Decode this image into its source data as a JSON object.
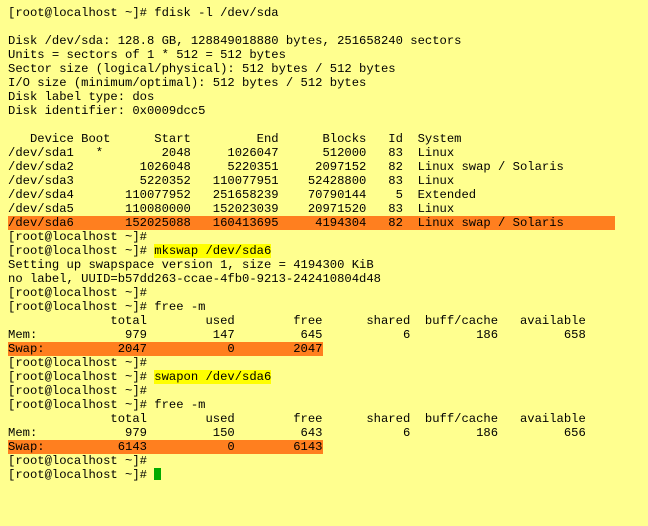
{
  "prompt": "[root@localhost ~]# ",
  "cmd_fdisk": "fdisk -l /dev/sda",
  "cmd_mkswap": "mkswap /dev/sda6",
  "cmd_free": "free -m",
  "cmd_swapon": "swapon /dev/sda6",
  "disk_header": {
    "l1": "Disk /dev/sda: 128.8 GB, 128849018880 bytes, 251658240 sectors",
    "l2": "Units = sectors of 1 * 512 = 512 bytes",
    "l3": "Sector size (logical/physical): 512 bytes / 512 bytes",
    "l4": "I/O size (minimum/optimal): 512 bytes / 512 bytes",
    "l5": "Disk label type: dos",
    "l6": "Disk identifier: 0x0009dcc5"
  },
  "part_header": "   Device Boot      Start         End      Blocks   Id  System",
  "partitions": [
    "/dev/sda1   *        2048     1026047      512000   83  Linux",
    "/dev/sda2         1026048     5220351     2097152   82  Linux swap / Solaris",
    "/dev/sda3         5220352   110077951    52428800   83  Linux",
    "/dev/sda4       110077952   251658239    70790144    5  Extended",
    "/dev/sda5       110080000   152023039    20971520   83  Linux"
  ],
  "partition6": "/dev/sda6       152025088   160413695     4194304   82  Linux swap / Solaris       ",
  "mkswap_out": {
    "l1": "Setting up swapspace version 1, size = 4194300 KiB",
    "l2": "no label, UUID=b57dd263-ccae-4fb0-9213-242410804d48"
  },
  "free_header": "              total        used        free      shared  buff/cache   available",
  "free1": {
    "mem": "Mem:            979         147         645           6         186         658",
    "swap": "Swap:          2047           0        2047"
  },
  "free2": {
    "mem": "Mem:            979         150         643           6         186         656",
    "swap": "Swap:          6143           0        6143"
  },
  "chart_data": {
    "type": "table",
    "partitions": {
      "columns": [
        "Device",
        "Boot",
        "Start",
        "End",
        "Blocks",
        "Id",
        "System"
      ],
      "rows": [
        [
          "/dev/sda1",
          "*",
          2048,
          1026047,
          512000,
          "83",
          "Linux"
        ],
        [
          "/dev/sda2",
          "",
          1026048,
          5220351,
          2097152,
          "82",
          "Linux swap / Solaris"
        ],
        [
          "/dev/sda3",
          "",
          5220352,
          110077951,
          52428800,
          "83",
          "Linux"
        ],
        [
          "/dev/sda4",
          "",
          110077952,
          251658239,
          70790144,
          "5",
          "Extended"
        ],
        [
          "/dev/sda5",
          "",
          110080000,
          152023039,
          20971520,
          "83",
          "Linux"
        ],
        [
          "/dev/sda6",
          "",
          152025088,
          160413695,
          4194304,
          "82",
          "Linux swap / Solaris"
        ]
      ]
    },
    "free_before": {
      "columns": [
        "",
        "total",
        "used",
        "free",
        "shared",
        "buff/cache",
        "available"
      ],
      "rows": [
        [
          "Mem",
          979,
          147,
          645,
          6,
          186,
          658
        ],
        [
          "Swap",
          2047,
          0,
          2047,
          null,
          null,
          null
        ]
      ]
    },
    "free_after": {
      "columns": [
        "",
        "total",
        "used",
        "free",
        "shared",
        "buff/cache",
        "available"
      ],
      "rows": [
        [
          "Mem",
          979,
          150,
          643,
          6,
          186,
          656
        ],
        [
          "Swap",
          6143,
          0,
          6143,
          null,
          null,
          null
        ]
      ]
    }
  }
}
